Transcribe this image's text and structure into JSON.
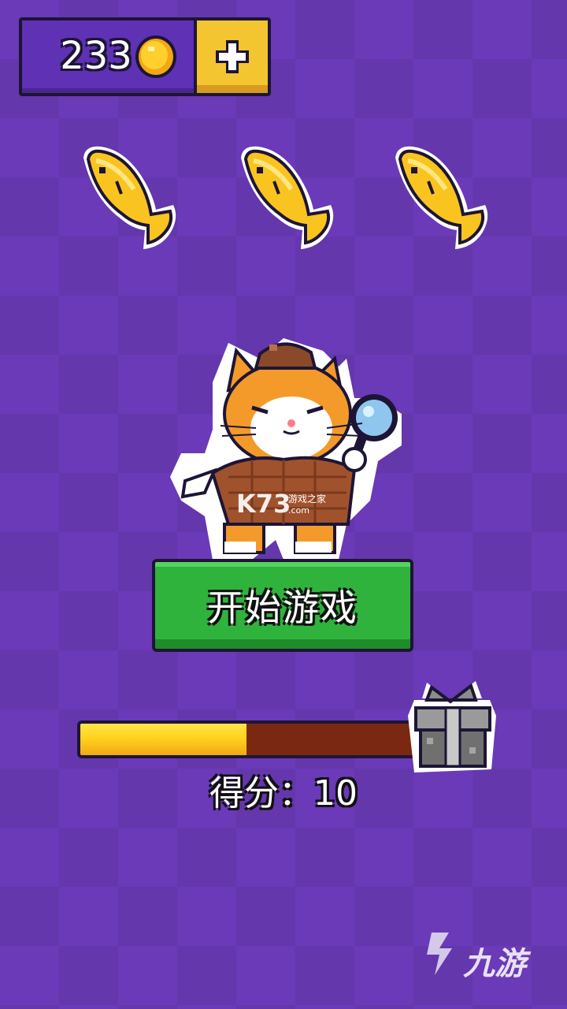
{
  "hud": {
    "coins": "233",
    "coin_icon": "gold-coin-icon",
    "add_icon": "plus-icon"
  },
  "fish_lives": {
    "count": 3,
    "icon": "fish-icon",
    "color": "#f9c420"
  },
  "character": {
    "icon": "detective-cat-icon"
  },
  "watermark": {
    "k73_text": "K73",
    "k73_sub": "游戏之家",
    "k73_domain": ".com",
    "jiuyou_text": "九游"
  },
  "start_button": {
    "label": "开始游戏"
  },
  "progress": {
    "value": 0.5,
    "reward_icon": "gift-box-icon"
  },
  "score": {
    "text": "得分：10"
  },
  "colors": {
    "background": "#6a3ab8",
    "start_button": "#2fb33d",
    "progress_fill": "#ffd31d",
    "progress_track": "#7a2812"
  }
}
